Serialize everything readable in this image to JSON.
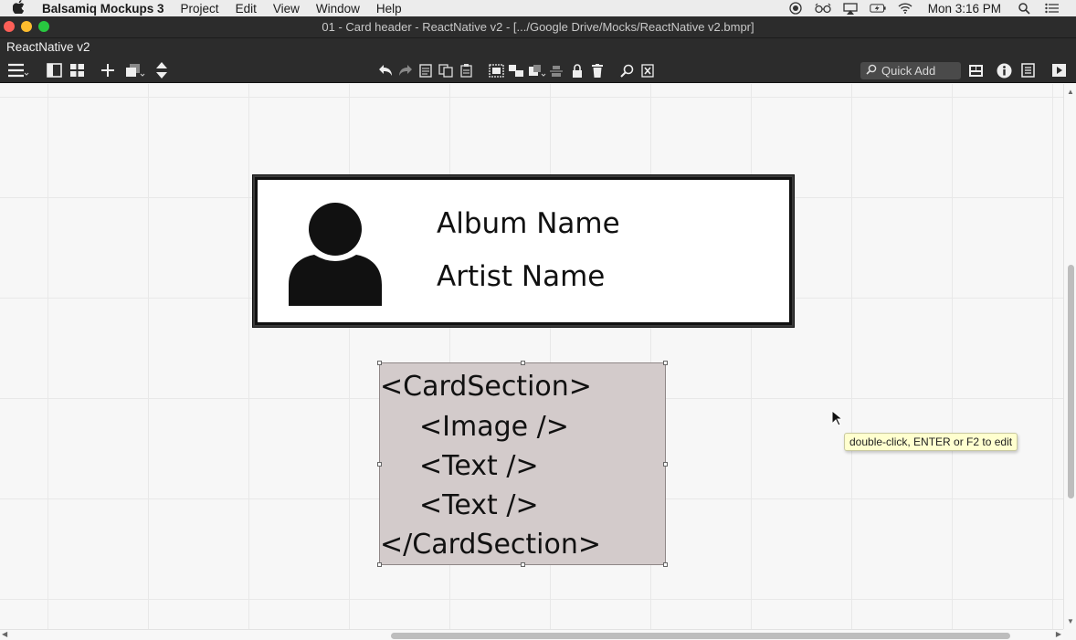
{
  "menubar": {
    "apple_icon": "apple-icon",
    "app_name": "Balsamiq Mockups 3",
    "items": [
      "Project",
      "Edit",
      "View",
      "Window",
      "Help"
    ],
    "clock": "Mon 3:16 PM"
  },
  "window": {
    "title": "01 - Card header - ReactNative v2 - [.../Google Drive/Mocks/ReactNative v2.bmpr]",
    "project_name": "ReactNative v2"
  },
  "toolbar": {
    "quick_add_placeholder": "Quick Add"
  },
  "mockup": {
    "album_name": "Album Name",
    "artist_name": "Artist Name",
    "section_lines": [
      "<CardSection>",
      "<Image />",
      "<Text />",
      "<Text />",
      "</CardSection>"
    ]
  },
  "tooltip": {
    "text": "double-click, ENTER or F2 to edit"
  }
}
